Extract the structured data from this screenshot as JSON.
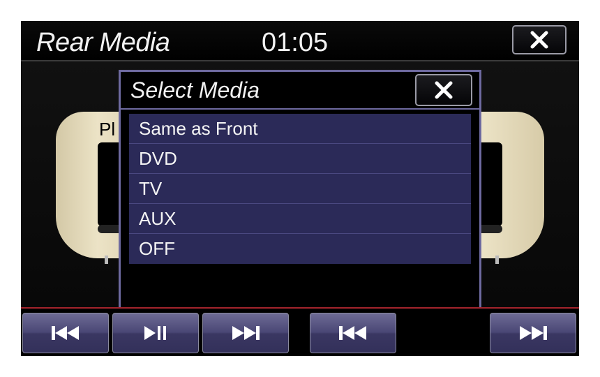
{
  "header": {
    "title": "Rear Media",
    "clock": "01:05",
    "close_icon": "close-icon"
  },
  "background": {
    "partial_text": "Pl"
  },
  "popup": {
    "title": "Select Media",
    "close_icon": "close-icon",
    "items": [
      {
        "label": "Same as Front"
      },
      {
        "label": "DVD"
      },
      {
        "label": "TV"
      },
      {
        "label": "AUX"
      },
      {
        "label": "OFF"
      }
    ]
  },
  "controls": [
    {
      "icon": "skip-back-icon"
    },
    {
      "icon": "play-pause-icon"
    },
    {
      "icon": "skip-forward-icon"
    },
    {
      "icon": "skip-back-icon"
    },
    {
      "icon": "skip-forward-icon"
    }
  ],
  "colors": {
    "accent": "#6e6aa0",
    "list_item": "#2b2a58",
    "divider_red": "#a3242c"
  }
}
